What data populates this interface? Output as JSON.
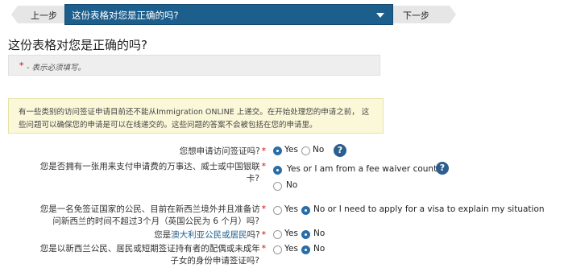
{
  "wizard": {
    "prev_label": "上一步",
    "current_page": "这份表格对您是正确的吗?",
    "next_label": "下一步"
  },
  "page_title": "这份表格对您是正确的吗?",
  "required_note": {
    "star": "*",
    "text": " - 表示必须填写。"
  },
  "notice": {
    "line1": "有一些类别的访问签证申请目前还不能从Immigration ONLINE 上递交。在开始处理您的申请之前， 这",
    "line2": "些问题可以确保您的申请是可以在线递交的。这些问题的答案不会被包括在您的申请里。"
  },
  "questions": [
    {
      "label": "您想申请访问签证吗?",
      "options": [
        {
          "label": "Yes",
          "selected": true
        },
        {
          "label": "No",
          "selected": false
        }
      ],
      "help": "?"
    },
    {
      "label_line1": "您是否拥有一张用来支付申请费的万事达、威士或中国银联",
      "label_line2": "卡?",
      "options": [
        {
          "label": "Yes or I am from a fee waiver country",
          "selected": true
        },
        {
          "label": "No",
          "selected": false
        }
      ],
      "help": "?"
    },
    {
      "label_line1": "您是一名免签证国家的公民、目前在新西兰境外并且准备访",
      "label_line2": "问新西兰的时间不超过3个月（英国公民为 6 个月）吗?",
      "options": [
        {
          "label": "Yes",
          "selected": false
        },
        {
          "label": "No or I need to apply for a visa to explain my situation",
          "selected": true
        }
      ]
    },
    {
      "label_prefix": "您是",
      "label_link": "澳大利亚公民或居民",
      "label_suffix": "吗?",
      "options": [
        {
          "label": "Yes",
          "selected": false
        },
        {
          "label": "No",
          "selected": true
        }
      ]
    },
    {
      "label_line1": "您是以新西兰公民、居民或短期签证持有者的配偶或未成年",
      "label_line2": "子女的身份申请签证吗?",
      "options": [
        {
          "label": "Yes",
          "selected": false
        },
        {
          "label": "No",
          "selected": true
        }
      ]
    }
  ],
  "required_star": "*",
  "colors": {
    "accent": "#1c5e8c",
    "required": "#dd0000",
    "notice_bg": "#fbf8d9"
  }
}
